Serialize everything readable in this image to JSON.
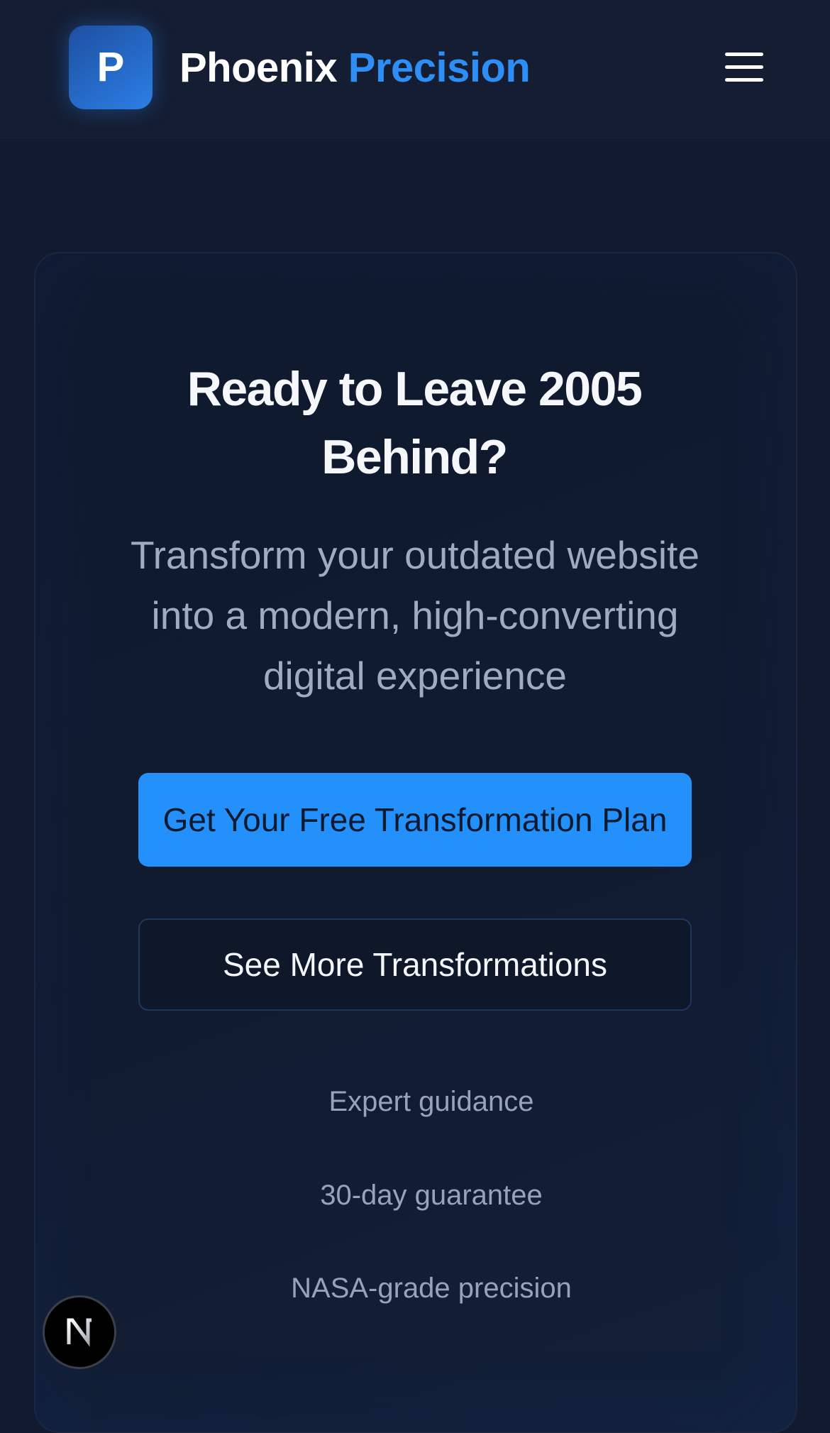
{
  "header": {
    "logo_letter": "P",
    "brand_primary": "Phoenix",
    "brand_accent": "Precision",
    "menu_icon": "hamburger-menu-icon"
  },
  "cta": {
    "headline": "Ready to Leave 2005 Behind?",
    "subtitle": "Transform your outdated website into a modern, high-converting digital experience",
    "primary_button": "Get Your Free Transformation Plan",
    "secondary_button": "See More Transformations",
    "features": [
      "Expert guidance",
      "30-day guarantee",
      "NASA-grade precision"
    ]
  },
  "dev_badge": {
    "letter": "N"
  },
  "colors": {
    "background": "#111a2e",
    "accent": "#2490fb",
    "brand_accent": "#2d8ef5",
    "muted_text": "#9eabc1"
  }
}
